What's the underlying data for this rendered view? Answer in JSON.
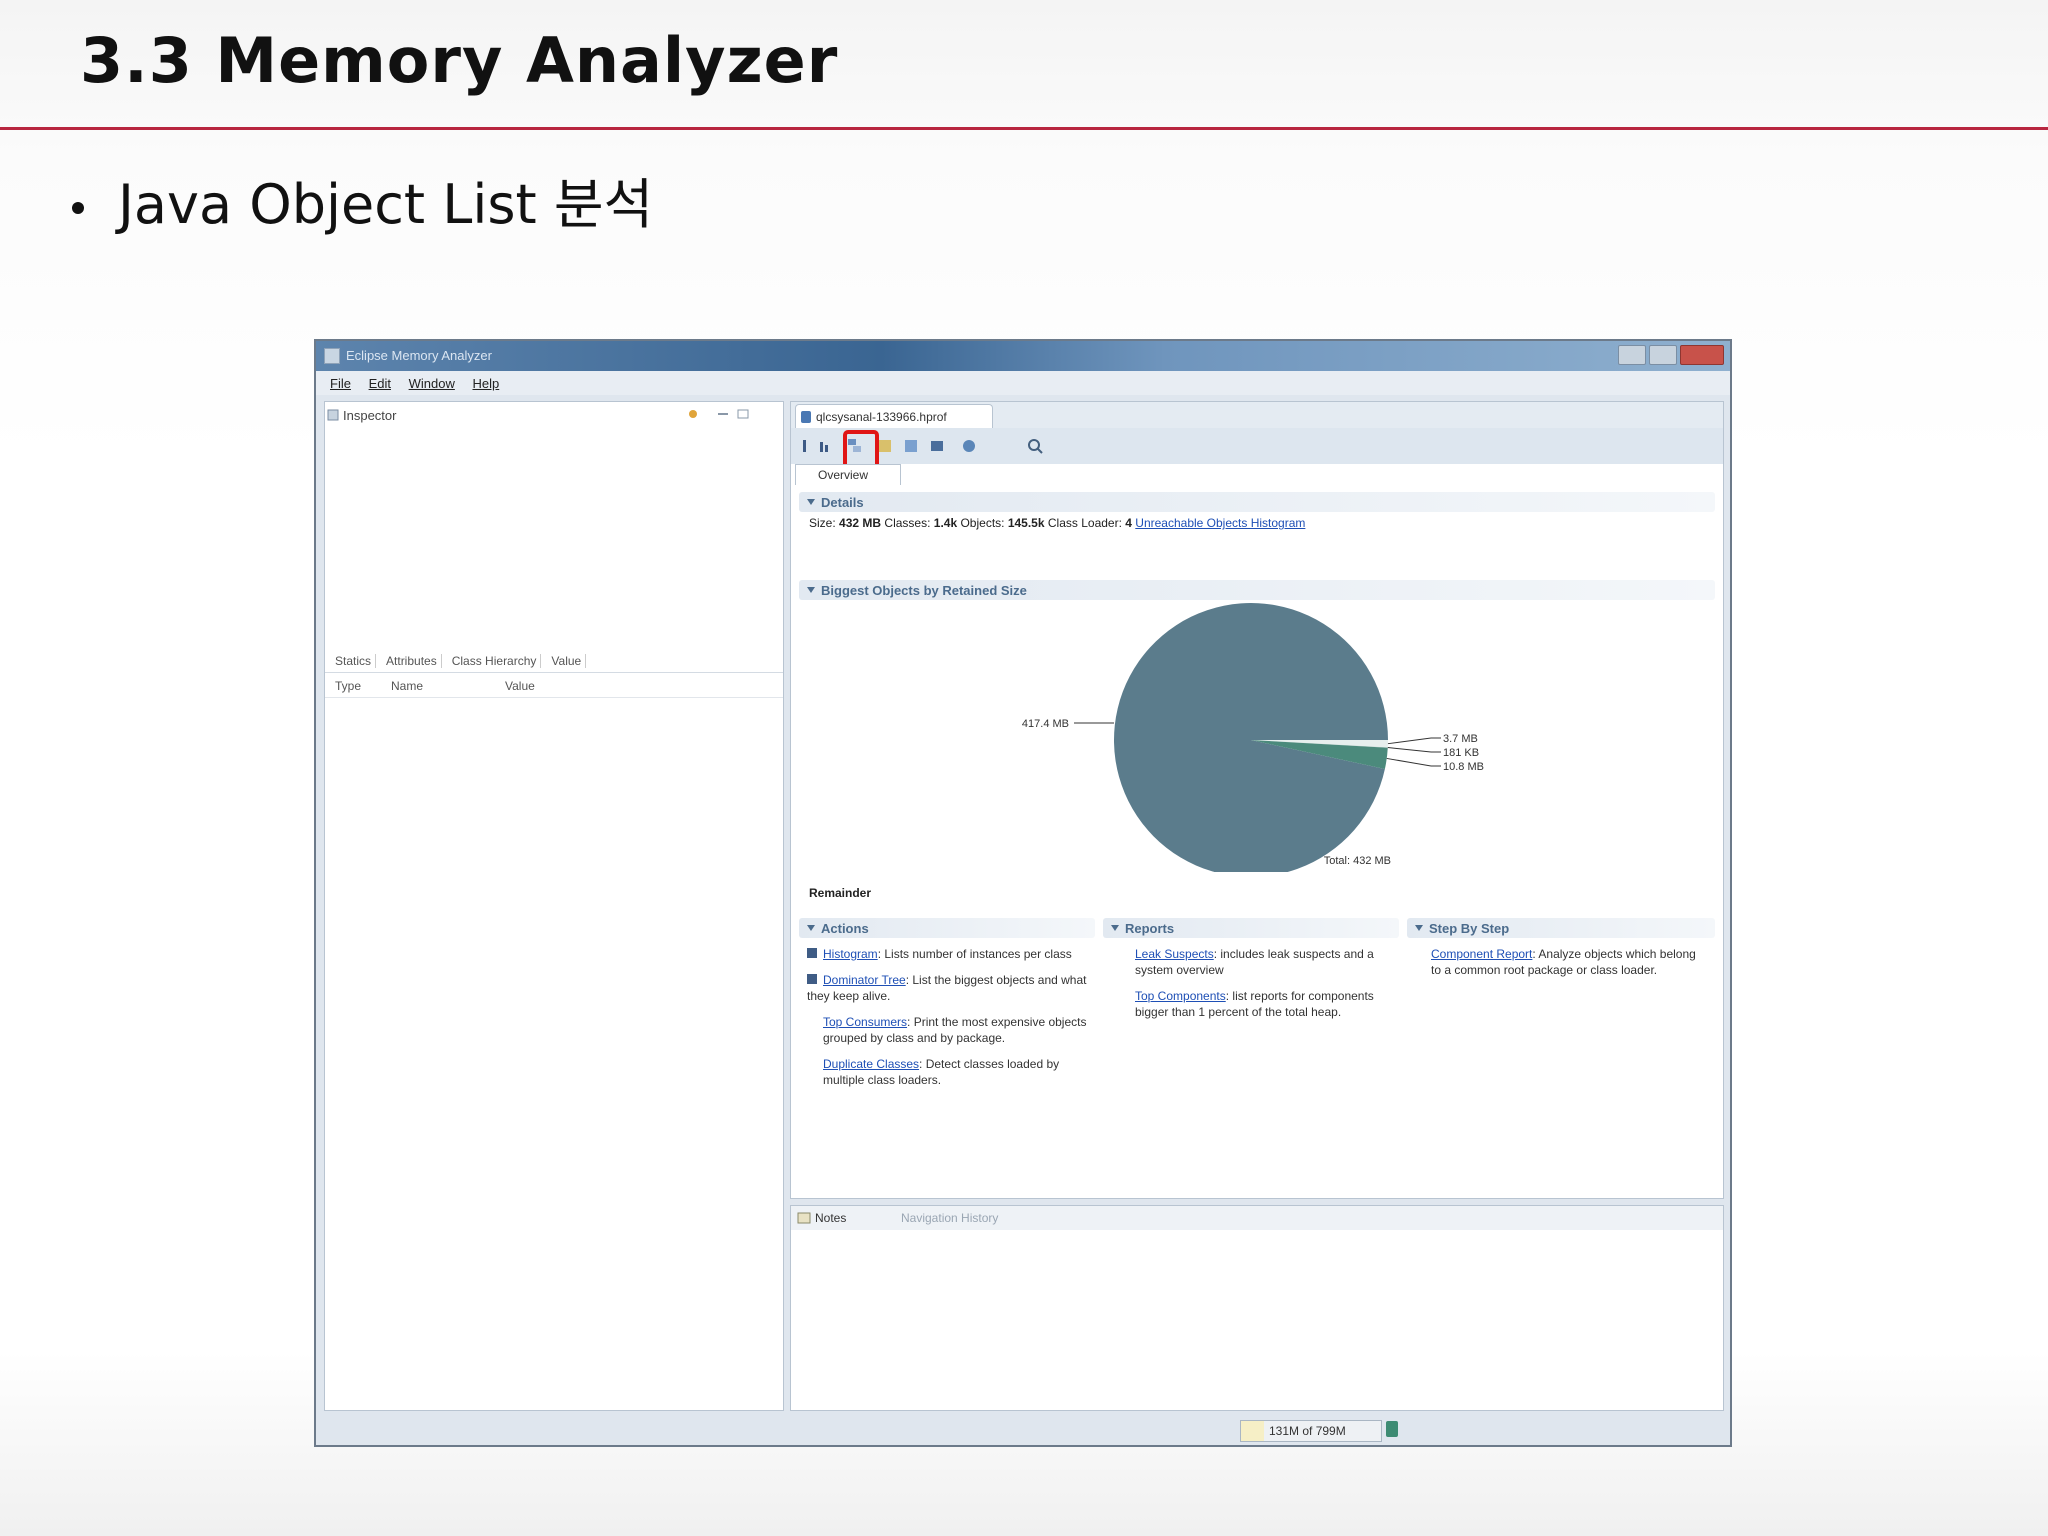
{
  "slide": {
    "title": "3.3 Memory Analyzer",
    "bullet": "Java Object List 분석"
  },
  "window": {
    "title": "Eclipse Memory Analyzer",
    "menu": [
      "File",
      "Edit",
      "Window",
      "Help"
    ],
    "inspector": {
      "tab_label": "Inspector",
      "subtabs": [
        "Statics",
        "Attributes",
        "Class Hierarchy",
        "Value"
      ],
      "columns": [
        "Type",
        "Name",
        "Value"
      ]
    },
    "editor": {
      "tab_label": "qlcsysanal-133966.hprof",
      "overview_tab": "Overview",
      "details_header": "Details",
      "details": {
        "size_label": "Size:",
        "size": "432 MB",
        "classes_label": "Classes:",
        "classes": "1.4k",
        "objects_label": "Objects:",
        "objects": "145.5k",
        "loader_label": "Class Loader:",
        "loader": "4",
        "link": "Unreachable Objects Histogram"
      },
      "biggest_header": "Biggest Objects by Retained Size",
      "remainder": "Remainder",
      "actions_header": "Actions",
      "reports_header": "Reports",
      "step_header": "Step By Step",
      "actions": [
        {
          "link": "Histogram",
          "text": ": Lists number of instances per class"
        },
        {
          "link": "Dominator Tree",
          "text": ": List the biggest objects and what they keep alive."
        },
        {
          "link": "Top Consumers",
          "text": ": Print the most expensive objects grouped by class and by package."
        },
        {
          "link": "Duplicate Classes",
          "text": ": Detect classes loaded by multiple class loaders."
        }
      ],
      "reports": [
        {
          "link": "Leak Suspects",
          "text": ": includes leak suspects and a system overview"
        },
        {
          "link": "Top Components",
          "text": ": list reports for components bigger than 1 percent of the total heap."
        }
      ],
      "steps": [
        {
          "link": "Component Report",
          "text": ": Analyze objects which belong to a common root package or class loader."
        }
      ]
    },
    "notes": {
      "tab_label": "Notes",
      "nav_label": "Navigation History"
    },
    "status": {
      "heap": "131M of 799M"
    }
  },
  "chart_data": {
    "type": "pie",
    "title": "",
    "unit": "MB",
    "slices": [
      {
        "label": "417.4 MB",
        "value": 417.4,
        "color": "#5b7c8c"
      },
      {
        "label": "3.7 MB",
        "value": 3.7,
        "color": "#e7efee"
      },
      {
        "label": "181 KB",
        "value": 0.18,
        "color": "#b9cfca"
      },
      {
        "label": "10.8 MB",
        "value": 10.8,
        "color": "#4b8a7c"
      }
    ],
    "total_label": "Total: 432 MB"
  }
}
